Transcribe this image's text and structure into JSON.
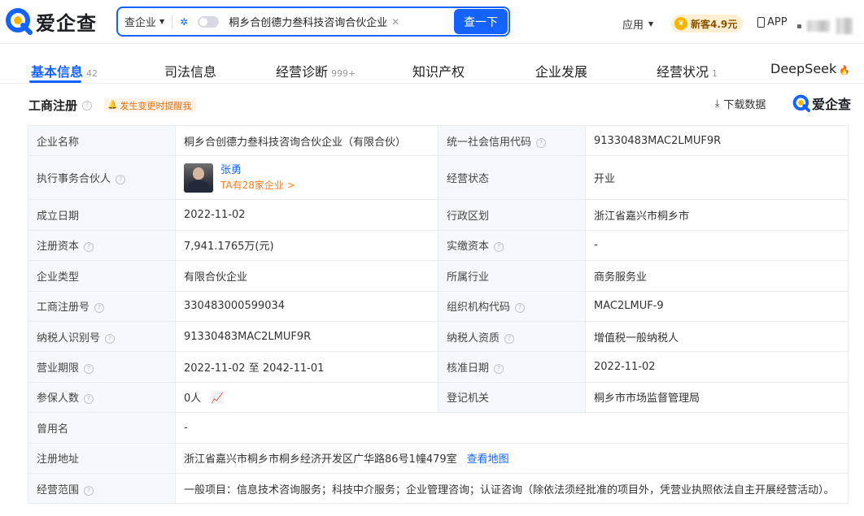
{
  "header": {
    "logo_text": "爱企查",
    "search": {
      "type_label": "查企业",
      "deep_think_label": "深度思考",
      "query": "桐乡合创德力叁科技咨询合伙企业",
      "button_label": "查一下"
    },
    "apps_label": "应用",
    "promo_label": "新客4.9元",
    "app_label": "APP"
  },
  "tabs": [
    {
      "label": "基本信息",
      "count": "42"
    },
    {
      "label": "司法信息",
      "count": ""
    },
    {
      "label": "经营诊断",
      "count": "999+"
    },
    {
      "label": "知识产权",
      "count": ""
    },
    {
      "label": "企业发展",
      "count": ""
    },
    {
      "label": "经营状况",
      "count": "1"
    },
    {
      "label": "DeepSeek",
      "count": ""
    }
  ],
  "section": {
    "title": "工商注册",
    "remind_label": "发生变更时提醒我",
    "download_label": "下载数据",
    "brand": "爱企查"
  },
  "info": {
    "name_label": "企业名称",
    "name_value": "桐乡合创德力叁科技咨询合伙企业（有限合伙）",
    "credit_label": "统一社会信用代码",
    "credit_value": "91330483MAC2LMUF9R",
    "partner_label": "执行事务合伙人",
    "partner_name": "张勇",
    "partner_sub": "TA有28家企业 >",
    "status_label": "经营状态",
    "status_value": "开业",
    "found_label": "成立日期",
    "found_value": "2022-11-02",
    "region_label": "行政区划",
    "region_value": "浙江省嘉兴市桐乡市",
    "capital_label": "注册资本",
    "capital_value": "7,941.1765万(元)",
    "paid_label": "实缴资本",
    "paid_value": "-",
    "type_label": "企业类型",
    "type_value": "有限合伙企业",
    "industry_label": "所属行业",
    "industry_value": "商务服务业",
    "regno_label": "工商注册号",
    "regno_value": "330483000599034",
    "orgcode_label": "组织机构代码",
    "orgcode_value": "MAC2LMUF-9",
    "taxid_label": "纳税人识别号",
    "taxid_value": "91330483MAC2LMUF9R",
    "taxqual_label": "纳税人资质",
    "taxqual_value": "增值税一般纳税人",
    "term_label": "营业期限",
    "term_value": "2022-11-02 至 2042-11-01",
    "approve_label": "核准日期",
    "approve_value": "2022-11-02",
    "insured_label": "参保人数",
    "insured_value": "0人",
    "authority_label": "登记机关",
    "authority_value": "桐乡市市场监督管理局",
    "former_label": "曾用名",
    "former_value": "-",
    "address_label": "注册地址",
    "address_value": "浙江省嘉兴市桐乡市桐乡经济开发区广华路86号1幢479室",
    "map_link": "查看地图",
    "scope_label": "经营范围",
    "scope_value": "一般项目：信息技术咨询服务；科技中介服务；企业管理咨询；认证咨询（除依法须经批准的项目外，凭营业执照依法自主开展经营活动）。"
  },
  "colors": {
    "primary": "#1463ff",
    "accent_orange": "#ff7a1a",
    "key_cell_bg": "#f5f8fc"
  }
}
